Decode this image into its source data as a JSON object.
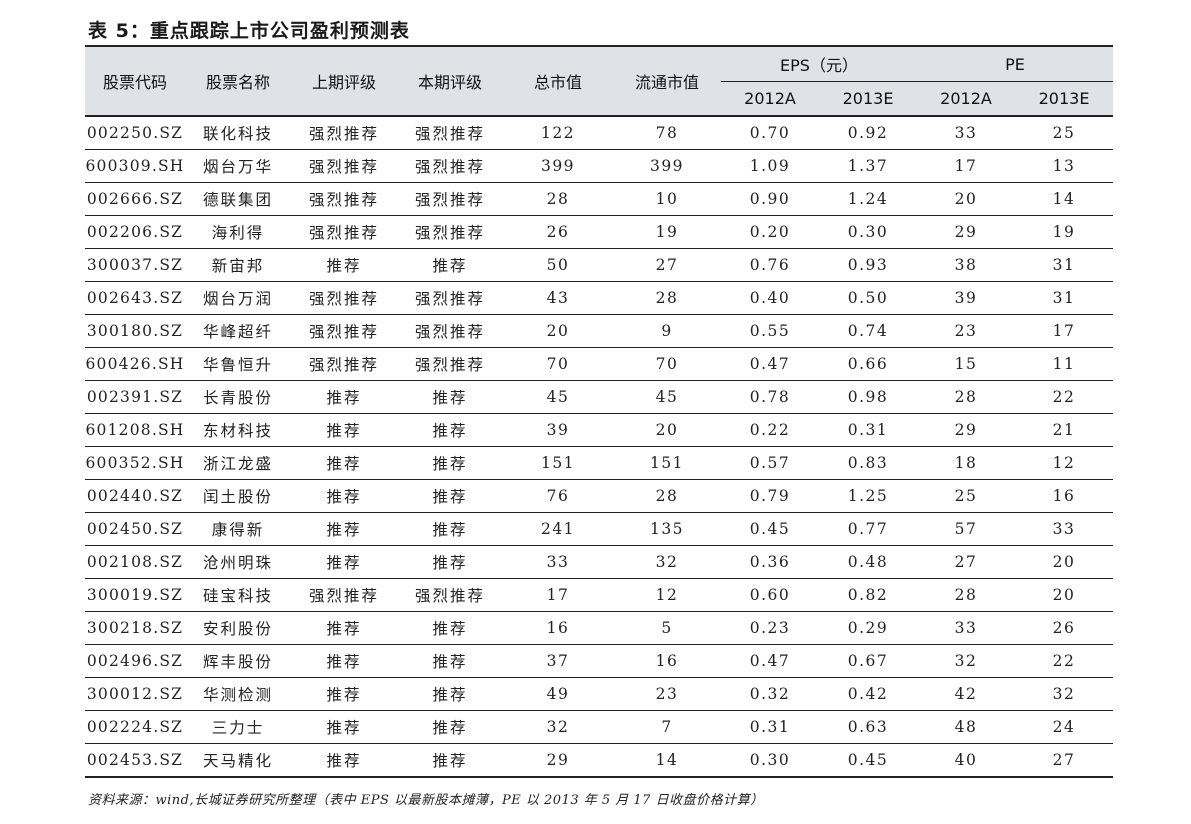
{
  "title": "表 5：重点跟踪上市公司盈利预测表",
  "headers": {
    "code": "股票代码",
    "name": "股票名称",
    "prev_rating": "上期评级",
    "curr_rating": "本期评级",
    "total_mcap": "总市值",
    "float_mcap": "流通市值",
    "eps_group": "EPS（元）",
    "pe_group": "PE",
    "year1": "2012A",
    "year2": "2013E"
  },
  "rows": [
    {
      "code": "002250.SZ",
      "name": "联化科技",
      "prev": "强烈推荐",
      "curr": "强烈推荐",
      "total": "122",
      "float": "78",
      "eps12": "0.70",
      "eps13": "0.92",
      "pe12": "33",
      "pe13": "25"
    },
    {
      "code": "600309.SH",
      "name": "烟台万华",
      "prev": "强烈推荐",
      "curr": "强烈推荐",
      "total": "399",
      "float": "399",
      "eps12": "1.09",
      "eps13": "1.37",
      "pe12": "17",
      "pe13": "13"
    },
    {
      "code": "002666.SZ",
      "name": "德联集团",
      "prev": "强烈推荐",
      "curr": "强烈推荐",
      "total": "28",
      "float": "10",
      "eps12": "0.90",
      "eps13": "1.24",
      "pe12": "20",
      "pe13": "14"
    },
    {
      "code": "002206.SZ",
      "name": "海利得",
      "prev": "强烈推荐",
      "curr": "强烈推荐",
      "total": "26",
      "float": "19",
      "eps12": "0.20",
      "eps13": "0.30",
      "pe12": "29",
      "pe13": "19"
    },
    {
      "code": "300037.SZ",
      "name": "新宙邦",
      "prev": "推荐",
      "curr": "推荐",
      "total": "50",
      "float": "27",
      "eps12": "0.76",
      "eps13": "0.93",
      "pe12": "38",
      "pe13": "31"
    },
    {
      "code": "002643.SZ",
      "name": "烟台万润",
      "prev": "强烈推荐",
      "curr": "强烈推荐",
      "total": "43",
      "float": "28",
      "eps12": "0.40",
      "eps13": "0.50",
      "pe12": "39",
      "pe13": "31"
    },
    {
      "code": "300180.SZ",
      "name": "华峰超纤",
      "prev": "强烈推荐",
      "curr": "强烈推荐",
      "total": "20",
      "float": "9",
      "eps12": "0.55",
      "eps13": "0.74",
      "pe12": "23",
      "pe13": "17"
    },
    {
      "code": "600426.SH",
      "name": "华鲁恒升",
      "prev": "强烈推荐",
      "curr": "强烈推荐",
      "total": "70",
      "float": "70",
      "eps12": "0.47",
      "eps13": "0.66",
      "pe12": "15",
      "pe13": "11"
    },
    {
      "code": "002391.SZ",
      "name": "长青股份",
      "prev": "推荐",
      "curr": "推荐",
      "total": "45",
      "float": "45",
      "eps12": "0.78",
      "eps13": "0.98",
      "pe12": "28",
      "pe13": "22"
    },
    {
      "code": "601208.SH",
      "name": "东材科技",
      "prev": "推荐",
      "curr": "推荐",
      "total": "39",
      "float": "20",
      "eps12": "0.22",
      "eps13": "0.31",
      "pe12": "29",
      "pe13": "21"
    },
    {
      "code": "600352.SH",
      "name": "浙江龙盛",
      "prev": "推荐",
      "curr": "推荐",
      "total": "151",
      "float": "151",
      "eps12": "0.57",
      "eps13": "0.83",
      "pe12": "18",
      "pe13": "12"
    },
    {
      "code": "002440.SZ",
      "name": "闰土股份",
      "prev": "推荐",
      "curr": "推荐",
      "total": "76",
      "float": "28",
      "eps12": "0.79",
      "eps13": "1.25",
      "pe12": "25",
      "pe13": "16"
    },
    {
      "code": "002450.SZ",
      "name": "康得新",
      "prev": "推荐",
      "curr": "推荐",
      "total": "241",
      "float": "135",
      "eps12": "0.45",
      "eps13": "0.77",
      "pe12": "57",
      "pe13": "33"
    },
    {
      "code": "002108.SZ",
      "name": "沧州明珠",
      "prev": "推荐",
      "curr": "推荐",
      "total": "33",
      "float": "32",
      "eps12": "0.36",
      "eps13": "0.48",
      "pe12": "27",
      "pe13": "20"
    },
    {
      "code": "300019.SZ",
      "name": "硅宝科技",
      "prev": "强烈推荐",
      "curr": "强烈推荐",
      "total": "17",
      "float": "12",
      "eps12": "0.60",
      "eps13": "0.82",
      "pe12": "28",
      "pe13": "20"
    },
    {
      "code": "300218.SZ",
      "name": "安利股份",
      "prev": "推荐",
      "curr": "推荐",
      "total": "16",
      "float": "5",
      "eps12": "0.23",
      "eps13": "0.29",
      "pe12": "33",
      "pe13": "26"
    },
    {
      "code": "002496.SZ",
      "name": "辉丰股份",
      "prev": "推荐",
      "curr": "推荐",
      "total": "37",
      "float": "16",
      "eps12": "0.47",
      "eps13": "0.67",
      "pe12": "32",
      "pe13": "22"
    },
    {
      "code": "300012.SZ",
      "name": "华测检测",
      "prev": "推荐",
      "curr": "推荐",
      "total": "49",
      "float": "23",
      "eps12": "0.32",
      "eps13": "0.42",
      "pe12": "42",
      "pe13": "32"
    },
    {
      "code": "002224.SZ",
      "name": "三力士",
      "prev": "推荐",
      "curr": "推荐",
      "total": "32",
      "float": "7",
      "eps12": "0.31",
      "eps13": "0.63",
      "pe12": "48",
      "pe13": "24"
    },
    {
      "code": "002453.SZ",
      "name": "天马精化",
      "prev": "推荐",
      "curr": "推荐",
      "total": "29",
      "float": "14",
      "eps12": "0.30",
      "eps13": "0.45",
      "pe12": "40",
      "pe13": "27"
    }
  ],
  "source": "资料来源：wind,长城证券研究所整理（表中 EPS 以最新股本摊薄，PE 以 2013 年 5 月 17 日收盘价格计算）"
}
